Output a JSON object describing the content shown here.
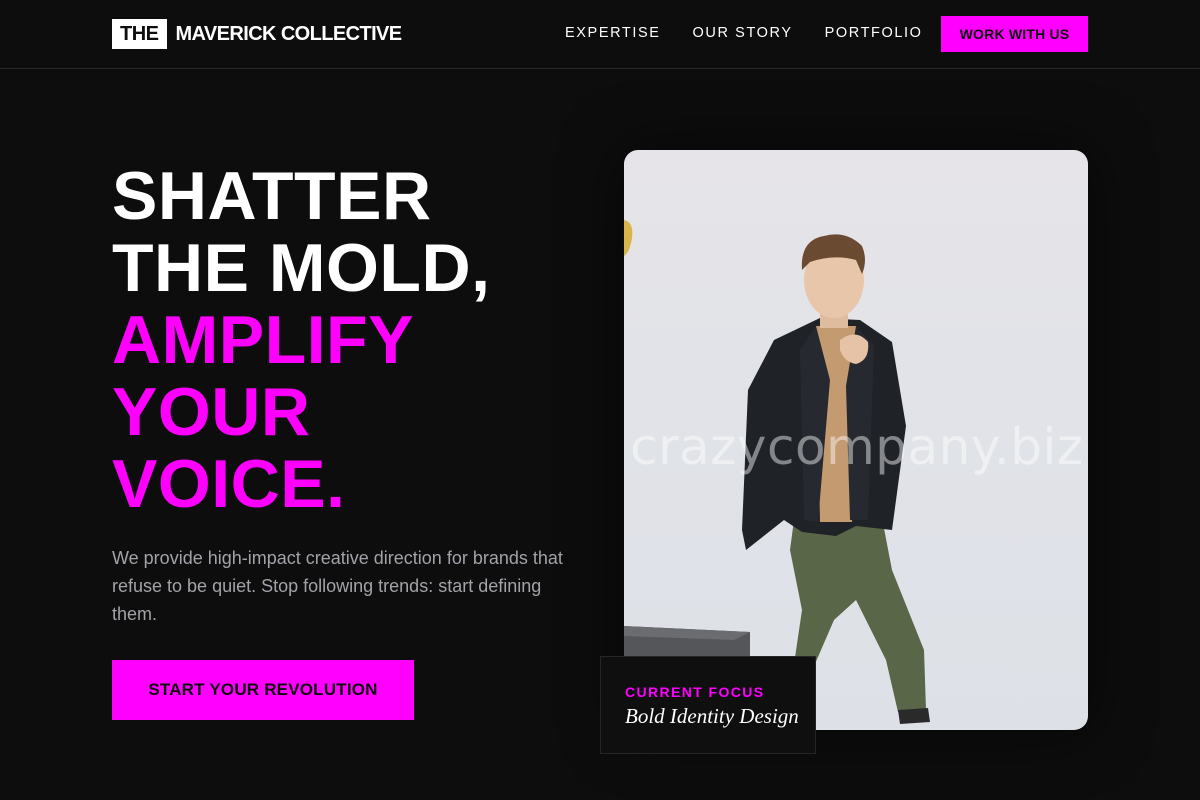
{
  "header": {
    "logo_box": "THE",
    "logo_text": "MAVERICK COLLECTIVE",
    "nav": [
      "EXPERTISE",
      "OUR STORY",
      "PORTFOLIO"
    ],
    "cta": "WORK WITH US"
  },
  "hero": {
    "title_lines": [
      "SHATTER",
      "THE MOLD,"
    ],
    "accent_lines": [
      "AMPLIFY",
      "YOUR",
      "VOICE."
    ],
    "description": "We provide high-impact creative direction for brands that refuse to be quiet. Stop following trends: start defining them.",
    "cta": "START YOUR REVOLUTION"
  },
  "photo": {
    "watermark": "crazycompany.biz",
    "focus_label": "CURRENT FOCUS",
    "focus_value": "Bold Identity Design"
  },
  "colors": {
    "background": "#0d0d0e",
    "accent": "#ff00ff",
    "muted_text": "#a2a2a8"
  }
}
